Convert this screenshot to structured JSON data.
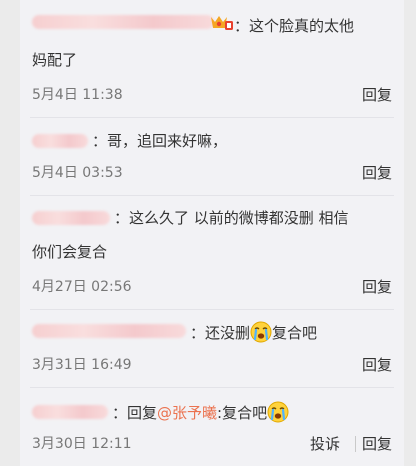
{
  "comments": [
    {
      "prefix": "：",
      "text": "这个脸真的太他",
      "text_cont": "妈配了",
      "time": "5月4日 11:38",
      "reply": "回复"
    },
    {
      "prefix": "：",
      "text": "哥，追回来好嘛，",
      "time": "5月4日 03:53",
      "reply": "回复"
    },
    {
      "prefix": "：",
      "text": "这么久了 以前的微博都没删  相信",
      "text_cont": "你们会复合",
      "time": "4月27日 02:56",
      "reply": "回复"
    },
    {
      "prefix": "：",
      "text_before": "还没删",
      "text_after": "复合吧",
      "emoji": "crying-face-icon",
      "time": "3月31日 16:49",
      "reply": "回复"
    },
    {
      "prefix": "：",
      "reply_word": "回复",
      "mention": "@张予曦",
      "after_mention": ":复合吧",
      "emoji": "crying-face-icon",
      "time": "3月30日 12:11",
      "report": "投诉",
      "reply": "回复"
    }
  ],
  "colors": {
    "mention": "#eb7350",
    "text": "#333333",
    "meta": "#777777",
    "background": "#f2f2f5"
  }
}
